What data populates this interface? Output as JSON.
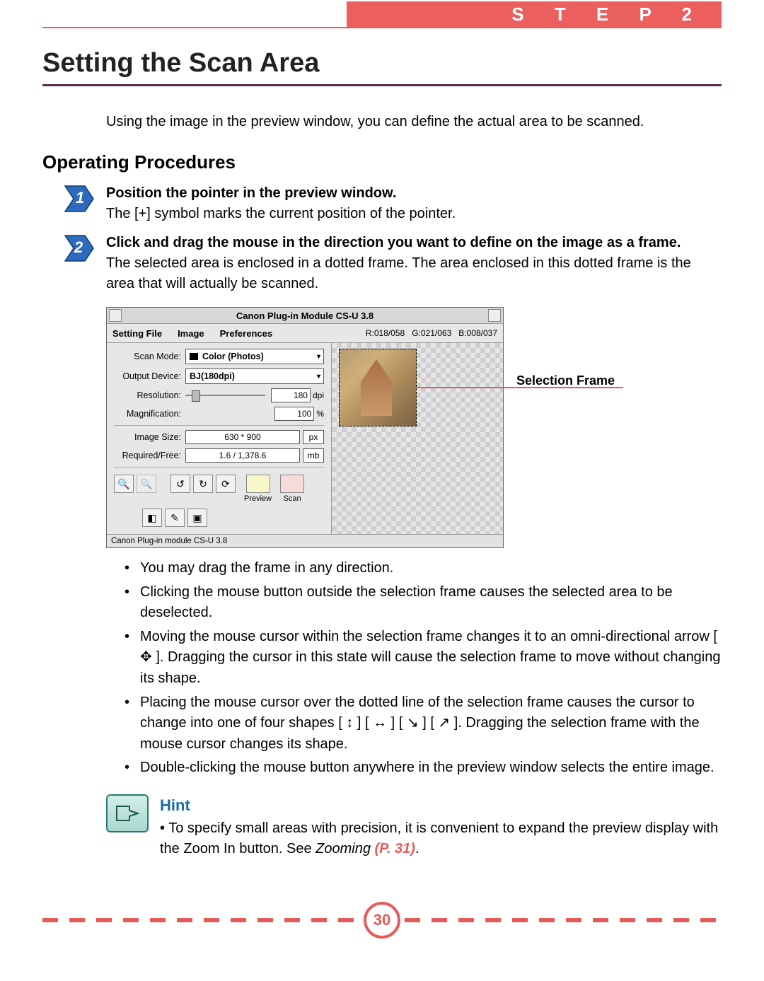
{
  "header": {
    "step_label": "S T E P   2"
  },
  "title": "Setting the Scan Area",
  "intro": "Using the image in the preview window, you can define the actual area to be scanned.",
  "section_heading": "Operating Procedures",
  "steps": [
    {
      "num": "1",
      "heading": "Position the pointer in the preview window.",
      "body": "The [+] symbol marks the current position of the pointer."
    },
    {
      "num": "2",
      "heading": "Click and drag the mouse in the direction you want to define on the image as a frame.",
      "body": "The selected area is enclosed in a dotted frame.  The area enclosed in this dotted frame is the area that will actually be scanned."
    }
  ],
  "screenshot": {
    "window_title": "Canon Plug-in Module CS-U 3.8",
    "menu": {
      "file": "Setting File",
      "image": "Image",
      "prefs": "Preferences"
    },
    "rgb": {
      "r": "R:018/058",
      "g": "G:021/063",
      "b": "B:008/037"
    },
    "labels": {
      "scan_mode": "Scan Mode:",
      "output_device": "Output Device:",
      "resolution": "Resolution:",
      "magnification": "Magnification:",
      "image_size": "Image Size:",
      "required_free": "Required/Free:"
    },
    "values": {
      "scan_mode": "Color (Photos)",
      "output_device": "BJ(180dpi)",
      "resolution": "180",
      "resolution_unit": "dpi",
      "magnification": "100",
      "magnification_unit": "%",
      "image_size": "630 * 900",
      "image_size_unit": "px",
      "required_free": "1.6 / 1,378.6",
      "required_free_unit": "mb"
    },
    "buttons": {
      "preview": "Preview",
      "scan": "Scan"
    },
    "status": "Canon Plug-in module CS-U 3.8",
    "callout": "Selection Frame"
  },
  "bullets": [
    "You may drag the frame in any direction.",
    "Clicking the mouse button outside the selection frame causes the selected area to be deselected.",
    "Moving the mouse cursor within the selection frame changes it to an omni-directional arrow [ ✥ ]. Dragging the cursor in this state will cause the selection frame to move without changing its shape.",
    "Placing the mouse cursor over the dotted line of the selection frame causes the cursor to change into one of four shapes [ ↕ ] [ ↔ ] [ ↘ ] [ ↗ ]. Dragging the selection frame with the mouse cursor changes its shape.",
    "Double-clicking the mouse button anywhere in the preview window selects the entire image."
  ],
  "hint": {
    "title": "Hint",
    "body_prefix": "• To specify small areas with precision, it is convenient to expand the preview display with the Zoom In button. See ",
    "zooming": "Zooming ",
    "ref": "(P. 31)",
    "suffix": "."
  },
  "page_number": "30"
}
